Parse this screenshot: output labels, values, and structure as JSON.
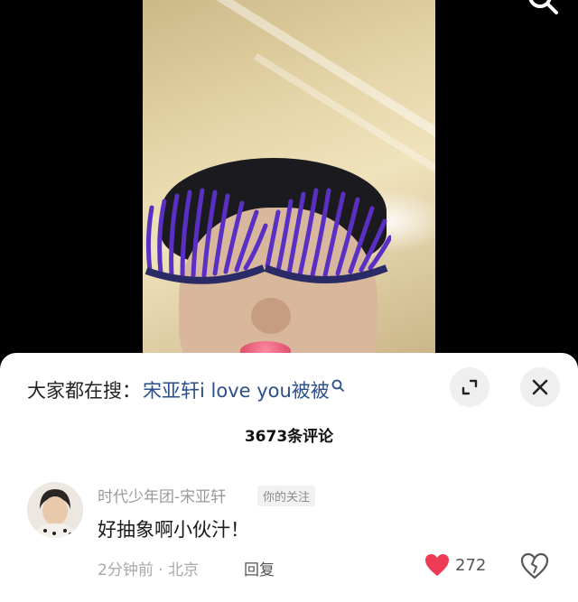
{
  "search_bar": {
    "prefix": "大家都在搜：",
    "term": "宋亚轩i love you被被"
  },
  "comments_header": {
    "count_label": "3673条评论"
  },
  "comment": {
    "author": "时代少年团-宋亚轩",
    "badge": "你的关注",
    "text": "好抽象啊小伙汁！",
    "meta": "2分钟前 · 北京",
    "reply_label": "回复",
    "like_count": "272"
  },
  "icons": {
    "search": "search-icon",
    "expand": "expand-icon",
    "close": "close-icon",
    "like": "heart-icon",
    "dislike": "broken-heart-icon"
  },
  "colors": {
    "search_term": "#2c4f8c",
    "like": "#ee3b55",
    "lashes": "#5a2fc4"
  }
}
